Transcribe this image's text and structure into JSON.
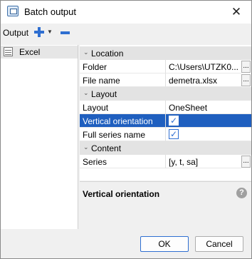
{
  "window": {
    "title": "Batch output"
  },
  "toolbar": {
    "output_label": "Output"
  },
  "output_list": {
    "items": [
      {
        "label": "Excel"
      }
    ]
  },
  "properties": {
    "location": {
      "category": "Location",
      "folder": {
        "name": "Folder",
        "value": "C:\\Users\\UTZK0..."
      },
      "file_name": {
        "name": "File name",
        "value": "demetra.xlsx"
      }
    },
    "layout": {
      "category": "Layout",
      "layout": {
        "name": "Layout",
        "value": "OneSheet"
      },
      "vertical_orientation": {
        "name": "Vertical orientation",
        "checked": true,
        "mark": "✓"
      },
      "full_series_name": {
        "name": "Full series name",
        "checked": true,
        "mark": "✓"
      }
    },
    "content": {
      "category": "Content",
      "series": {
        "name": "Series",
        "value": "[y, t, sa]"
      }
    },
    "ellipsis": "..."
  },
  "description": {
    "title": "Vertical orientation",
    "help_glyph": "?"
  },
  "buttons": {
    "ok": "OK",
    "cancel": "Cancel"
  },
  "glyphs": {
    "close": "✕",
    "dropdown": "▼",
    "collapse": "⌄"
  },
  "colors": {
    "selection": "#1f5fbf",
    "accent": "#2f6fd1"
  }
}
